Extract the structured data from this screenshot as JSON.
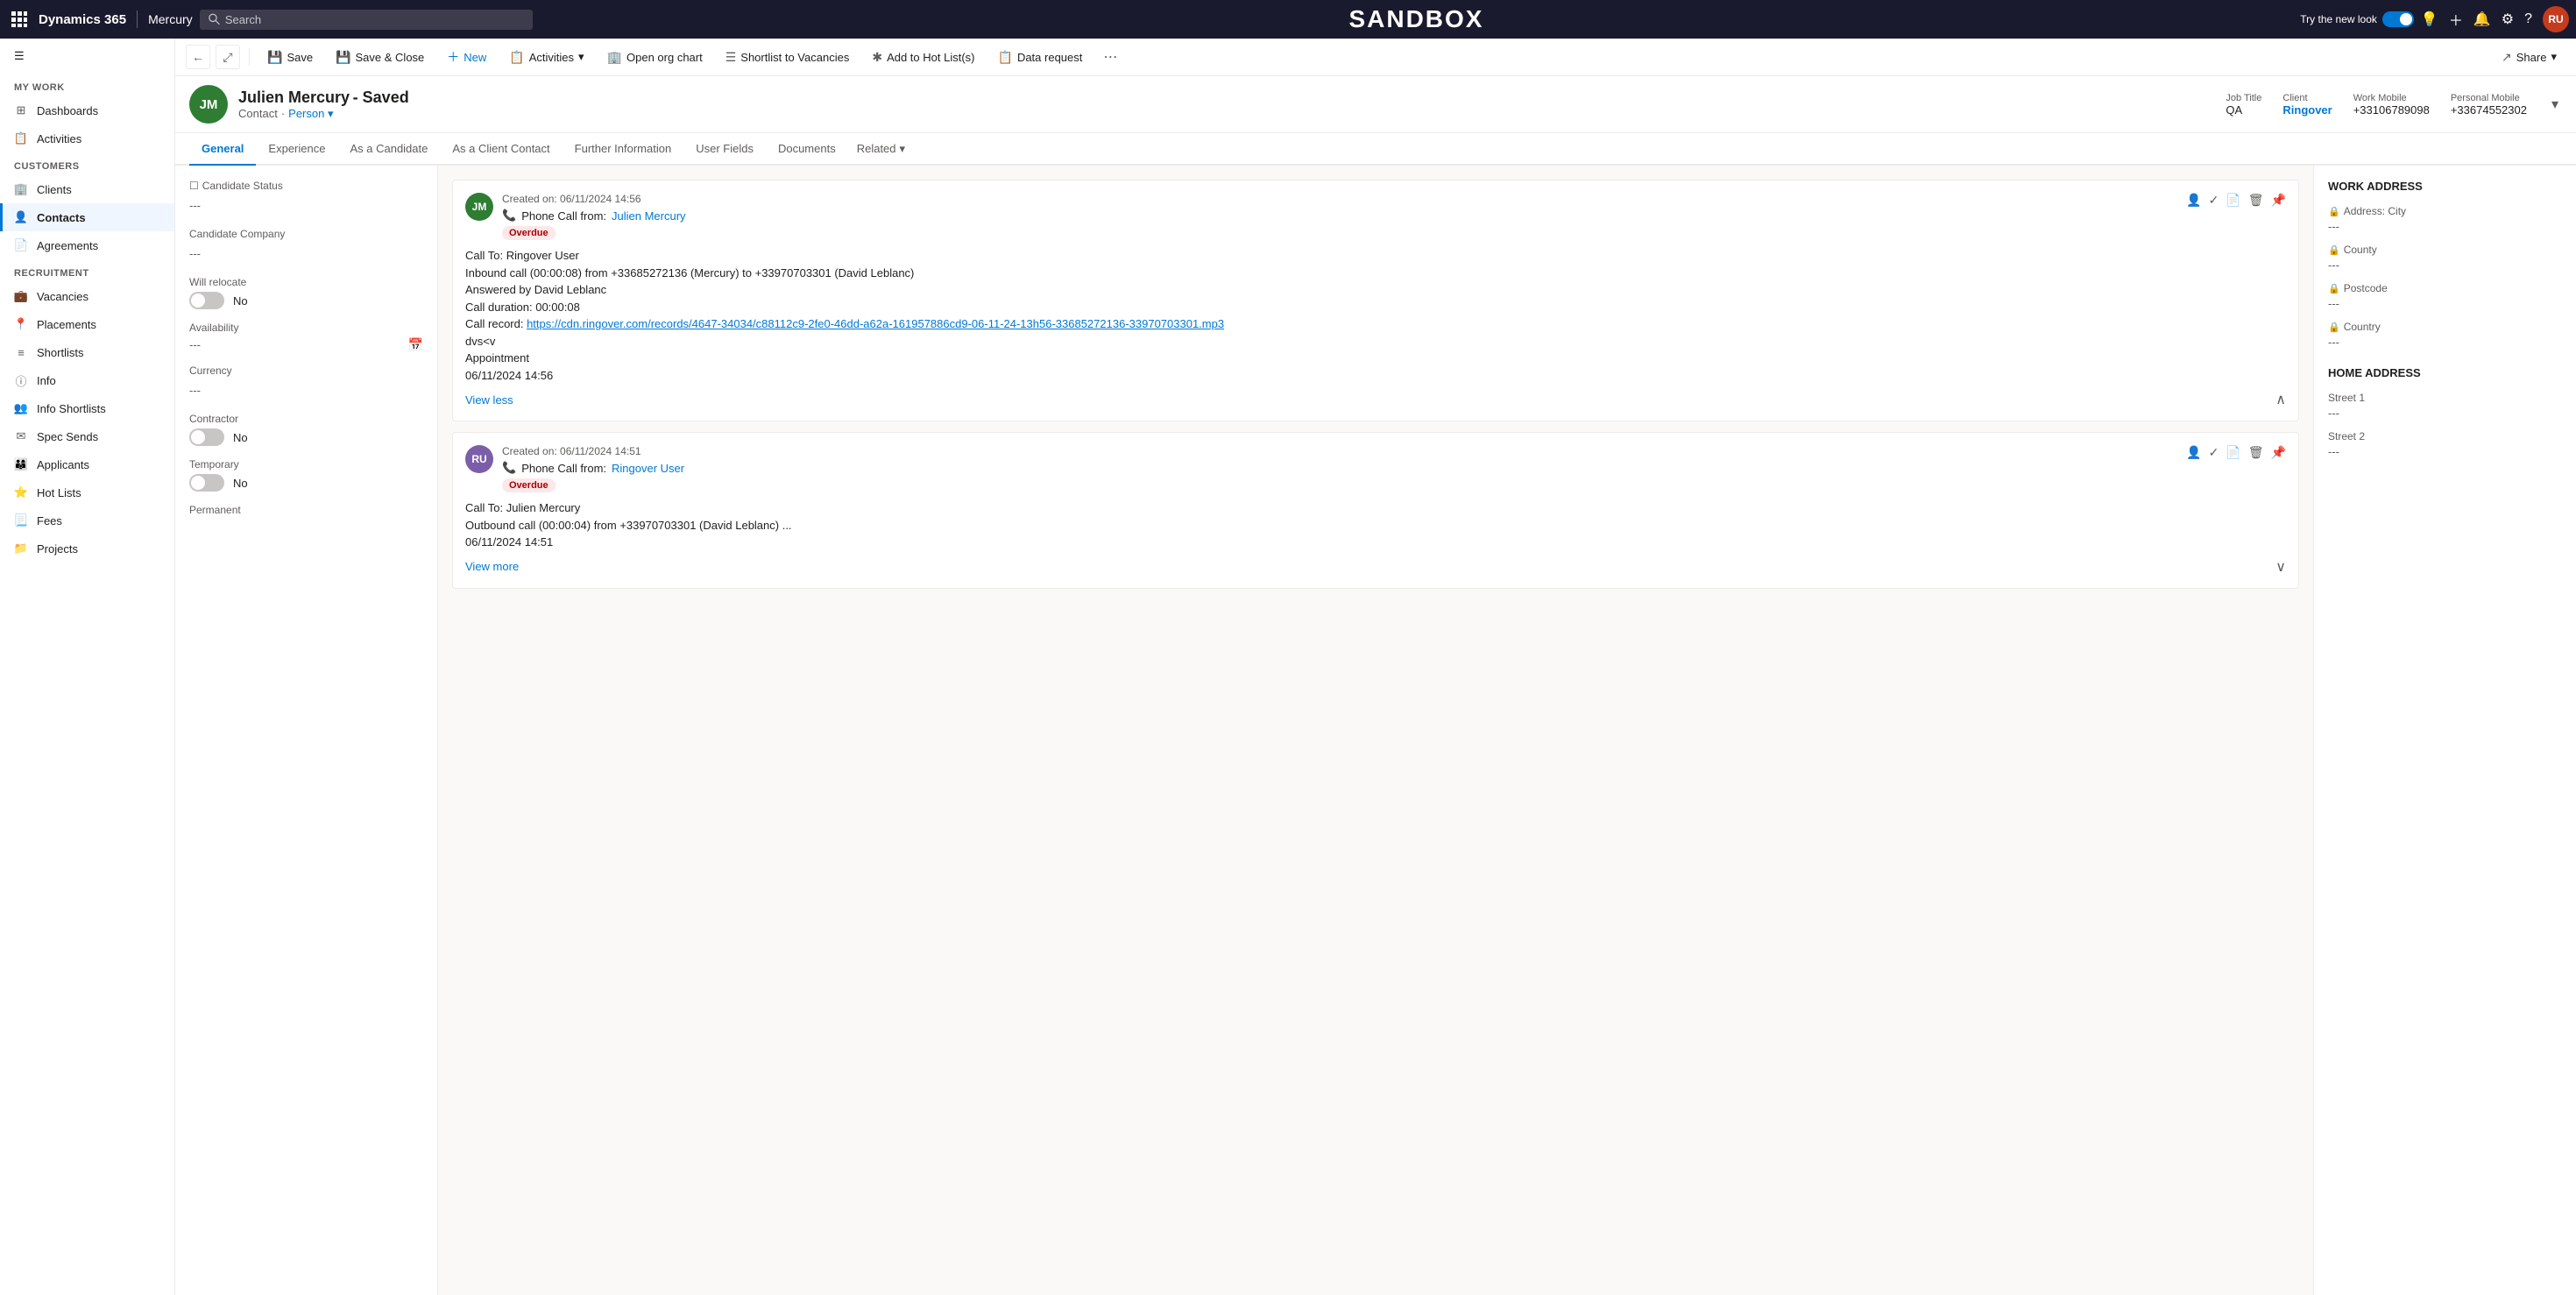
{
  "topnav": {
    "appName": "Dynamics 365",
    "moduleName": "Mercury",
    "searchPlaceholder": "Search",
    "sandboxLabel": "SANDBOX",
    "tryNewLook": "Try the new look",
    "userInitials": "RU"
  },
  "sidebar": {
    "myWork": "My Work",
    "items": [
      {
        "id": "dashboards",
        "label": "Dashboards",
        "icon": "grid"
      },
      {
        "id": "activities",
        "label": "Activities",
        "icon": "list"
      }
    ],
    "customers": "Customers",
    "customerItems": [
      {
        "id": "clients",
        "label": "Clients",
        "icon": "building"
      },
      {
        "id": "contacts",
        "label": "Contacts",
        "icon": "person",
        "active": true
      },
      {
        "id": "agreements",
        "label": "Agreements",
        "icon": "doc"
      }
    ],
    "recruitment": "Recruitment",
    "recruitmentItems": [
      {
        "id": "vacancies",
        "label": "Vacancies",
        "icon": "briefcase"
      },
      {
        "id": "placements",
        "label": "Placements",
        "icon": "pin"
      },
      {
        "id": "shortlists",
        "label": "Shortlists",
        "icon": "list2"
      },
      {
        "id": "info",
        "label": "Info",
        "icon": "info"
      },
      {
        "id": "info-shortlists",
        "label": "Info Shortlists",
        "icon": "person2"
      },
      {
        "id": "spec-sends",
        "label": "Spec Sends",
        "icon": "mail"
      },
      {
        "id": "applicants",
        "label": "Applicants",
        "icon": "people"
      },
      {
        "id": "hot-lists",
        "label": "Hot Lists",
        "icon": "star"
      },
      {
        "id": "fees",
        "label": "Fees",
        "icon": "doc2"
      },
      {
        "id": "projects",
        "label": "Projects",
        "icon": "folder"
      }
    ]
  },
  "commandBar": {
    "backTitle": "Back",
    "forwardTitle": "Forward",
    "expandTitle": "Expand",
    "saveLabel": "Save",
    "saveCloseLabel": "Save & Close",
    "newLabel": "New",
    "activitiesLabel": "Activities",
    "openOrgChartLabel": "Open org chart",
    "shortlistToVacanciesLabel": "Shortlist to Vacancies",
    "addToHotListLabel": "Add to Hot List(s)",
    "dataRequestLabel": "Data request",
    "shareLabel": "Share"
  },
  "record": {
    "initials": "JM",
    "avatarColor": "#2e7d32",
    "name": "Julien Mercury",
    "savedBadge": "- Saved",
    "type": "Contact",
    "subtype": "Person",
    "jobTitleLabel": "Job Title",
    "jobTitleValue": "QA",
    "clientLabel": "Client",
    "clientValue": "Ringover",
    "workMobileLabel": "Work Mobile",
    "workMobileValue": "+33106789098",
    "personalMobileLabel": "Personal Mobile",
    "personalMobileValue": "+33674552302"
  },
  "tabs": [
    {
      "id": "general",
      "label": "General",
      "active": true
    },
    {
      "id": "experience",
      "label": "Experience"
    },
    {
      "id": "as-candidate",
      "label": "As a Candidate"
    },
    {
      "id": "as-client-contact",
      "label": "As a Client Contact"
    },
    {
      "id": "further-information",
      "label": "Further Information"
    },
    {
      "id": "user-fields",
      "label": "User Fields"
    },
    {
      "id": "documents",
      "label": "Documents"
    },
    {
      "id": "related",
      "label": "Related"
    }
  ],
  "leftPanel": {
    "fields": [
      {
        "id": "candidate-status",
        "label": "Candidate Status",
        "value": "---"
      },
      {
        "id": "candidate-company",
        "label": "Candidate Company",
        "value": "---"
      },
      {
        "id": "will-relocate",
        "label": "Will relocate",
        "type": "toggle",
        "toggleValue": false,
        "toggleLabel": "No"
      },
      {
        "id": "availability",
        "label": "Availability",
        "type": "date",
        "value": "---"
      },
      {
        "id": "currency",
        "label": "Currency",
        "value": "---"
      },
      {
        "id": "contractor",
        "label": "Contractor",
        "type": "toggle",
        "toggleValue": false,
        "toggleLabel": "No"
      },
      {
        "id": "temporary",
        "label": "Temporary",
        "type": "toggle",
        "toggleValue": false,
        "toggleLabel": "No"
      },
      {
        "id": "permanent",
        "label": "Permanent",
        "value": ""
      }
    ]
  },
  "activities": [
    {
      "id": "act1",
      "avatarInitials": "JM",
      "avatarColor": "#2e7d32",
      "createdOn": "Created on: 06/11/2024 14:56",
      "type": "Phone Call from:",
      "fromName": "Julien Mercury",
      "overdue": true,
      "overdueLabel": "Overdue",
      "body": "Call To: Ringover User\nInbound call (00:00:08) from +33685272136 (Mercury) to +33970703301 (David Leblanc)\nAnswered by David Leblanc\nCall duration: 00:00:08\nCall record: https://cdn.ringover.com/records/4647-34034/c88112c9-2fe0-46dd-a62a-161957886cd9-06-11-24-13h56-33685272136-33970703301.mp3\ndvs<v\nAppointment\n06/11/2024 14:56",
      "viewToggle": "View less",
      "expanded": true
    },
    {
      "id": "act2",
      "avatarInitials": "RU",
      "avatarColor": "#7b5ea7",
      "createdOn": "Created on: 06/11/2024 14:51",
      "type": "Phone Call from:",
      "fromName": "Ringover User",
      "overdue": true,
      "overdueLabel": "Overdue",
      "body": "Call To: Julien Mercury\nOutbound call (00:00:04) from +33970703301 (David Leblanc) ...",
      "viewToggle": "View more",
      "expanded": false,
      "timestamp": "06/11/2024 14:51"
    }
  ],
  "rightPanel": {
    "workAddressTitle": "WORK ADDRESS",
    "workAddressFields": [
      {
        "id": "address-city",
        "label": "Address: City",
        "value": "---",
        "locked": true
      },
      {
        "id": "county",
        "label": "County",
        "value": "---",
        "locked": true
      },
      {
        "id": "postcode",
        "label": "Postcode",
        "value": "---",
        "locked": true
      },
      {
        "id": "country",
        "label": "Country",
        "value": "---",
        "locked": true
      }
    ],
    "homeAddressTitle": "HOME ADDRESS",
    "homeAddressFields": [
      {
        "id": "street1",
        "label": "Street 1",
        "value": "---"
      },
      {
        "id": "street2",
        "label": "Street 2",
        "value": "---"
      }
    ]
  }
}
